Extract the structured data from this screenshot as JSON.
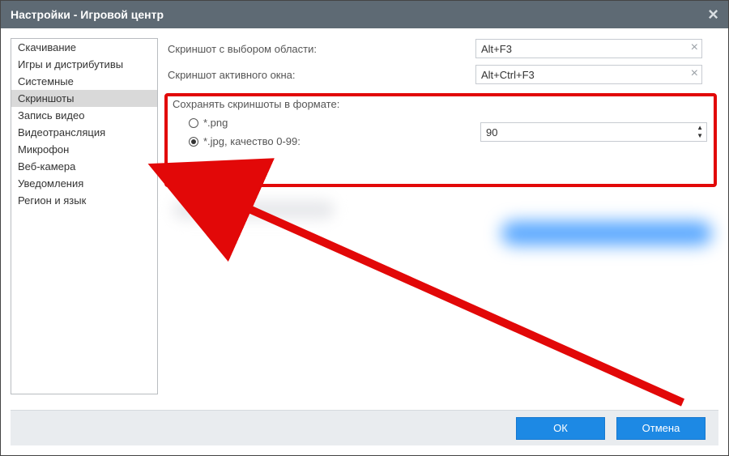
{
  "window": {
    "title": "Настройки - Игровой центр"
  },
  "sidebar": {
    "items": [
      "Скачивание",
      "Игры и дистрибутивы",
      "Системные",
      "Скриншоты",
      "Запись видео",
      "Видеотрансляция",
      "Микрофон",
      "Веб-камера",
      "Уведомления",
      "Регион и язык"
    ],
    "selected_index": 3
  },
  "hotkeys": {
    "area_label": "Скриншот с выбором области:",
    "area_value": "Alt+F3",
    "window_label": "Скриншот активного окна:",
    "window_value": "Alt+Ctrl+F3"
  },
  "format": {
    "title": "Сохранять скриншоты в формате:",
    "png_label": "*.png",
    "jpg_label": "*.jpg, качество 0-99:",
    "selected": "jpg",
    "quality_value": "90"
  },
  "footer": {
    "ok": "ОК",
    "cancel": "Отмена"
  }
}
